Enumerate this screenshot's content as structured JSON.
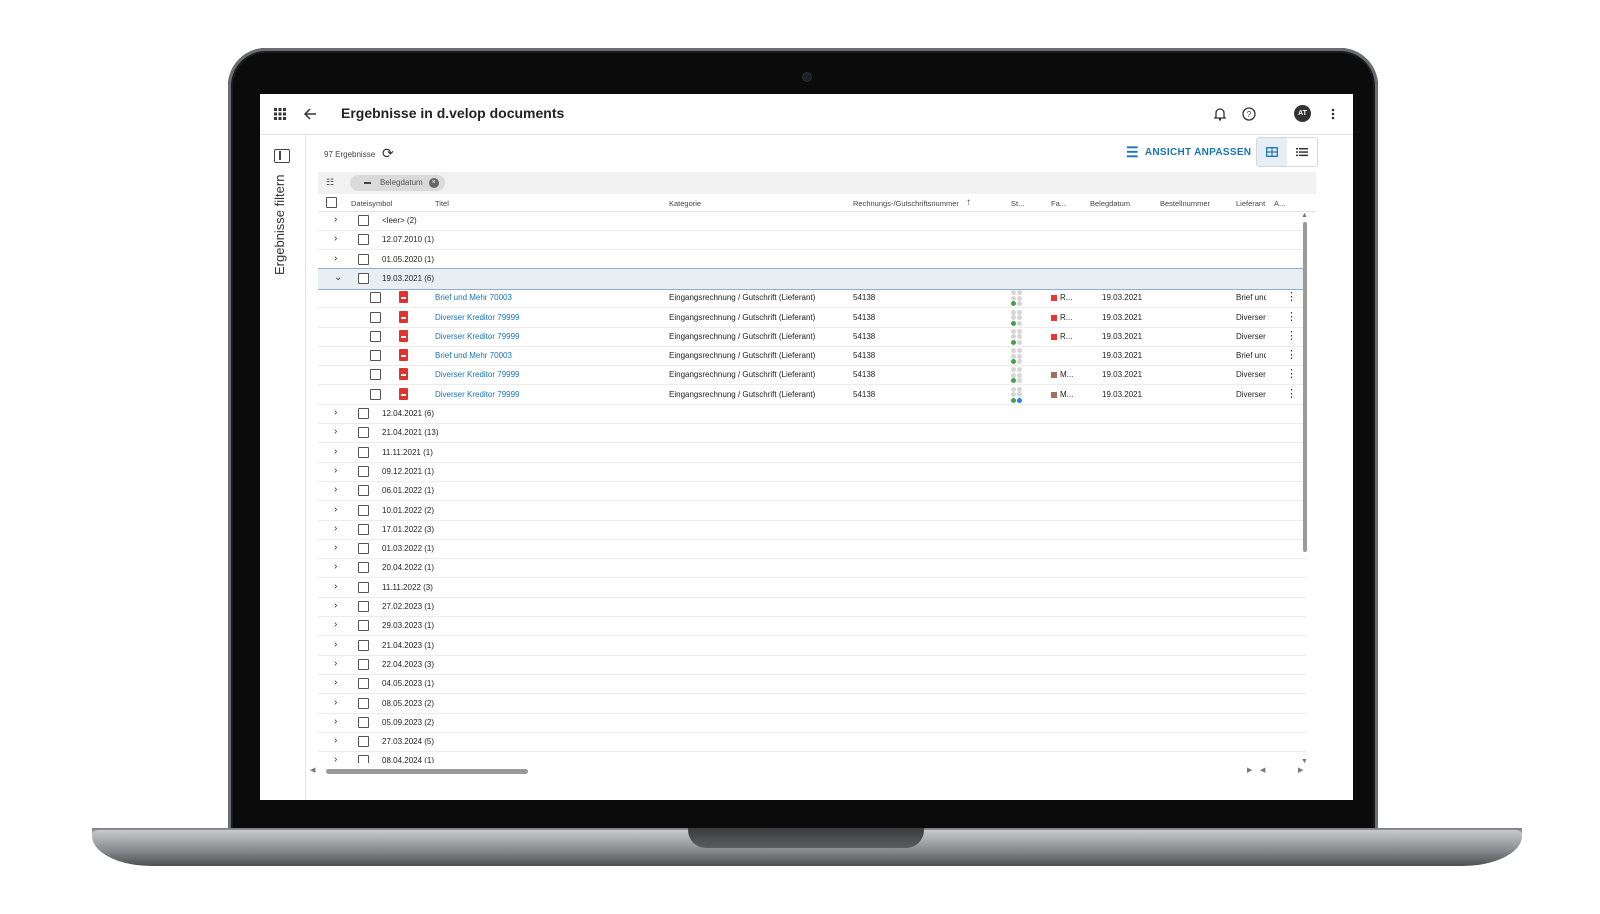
{
  "app": {
    "title": "Ergebnisse in d.velop documents",
    "avatar_initials": "AT",
    "icons": {
      "apps": "apps-grid-icon",
      "back": "arrow-back-icon",
      "notifications": "bell-icon",
      "help": "help-circle-icon",
      "more": "more-vert-icon"
    }
  },
  "sidebar": {
    "label": "Ergebnisse filtern"
  },
  "results": {
    "count_label": "97 Ergebnisse",
    "adjust_view_label": "ANSICHT ANPASSEN",
    "group_chip_label": "Belegdatum"
  },
  "table": {
    "columns": [
      "Dateisymbol",
      "Titel",
      "Kategorie",
      "Rechnungs-/Gutschriftsnummer",
      "St...",
      "Fa...",
      "Belegdatum",
      "Bestellnummer",
      "Lieferant",
      "A..."
    ],
    "sorted_column": "Rechnungs-/Gutschriftsnummer",
    "groups_top": [
      {
        "label": "<leer> (2)"
      },
      {
        "label": "12.07.2010 (1)"
      },
      {
        "label": "01.05.2020 (1)"
      }
    ],
    "expanded_group": {
      "label": "19.03.2021 (6)"
    },
    "docs": [
      {
        "title": "Brief und Mehr 70003",
        "category": "Eingangsrechnung / Gutschrift (Lieferant)",
        "number": "54138",
        "fa": "R...",
        "fa_color": "#e53935",
        "date": "19.03.2021",
        "supplier": "Brief und Mehr",
        "status": [
          "#d6d6d6",
          "#d6d6d6",
          "#d6d6d6",
          "#d6d6d6",
          "#43a047",
          "#d6d6d6"
        ]
      },
      {
        "title": "Diverser Kreditor 79999",
        "category": "Eingangsrechnung / Gutschrift (Lieferant)",
        "number": "54138",
        "fa": "R...",
        "fa_color": "#e53935",
        "date": "19.03.2021",
        "supplier": "Diverser Kreditor",
        "status": [
          "#d6d6d6",
          "#d6d6d6",
          "#d6d6d6",
          "#d6d6d6",
          "#43a047",
          "#d6d6d6"
        ]
      },
      {
        "title": "Diverser Kreditor 79999",
        "category": "Eingangsrechnung / Gutschrift (Lieferant)",
        "number": "54138",
        "fa": "R...",
        "fa_color": "#e53935",
        "date": "19.03.2021",
        "supplier": "Diverser Kreditor",
        "status": [
          "#d6d6d6",
          "#d6d6d6",
          "#d6d6d6",
          "#d6d6d6",
          "#43a047",
          "#d6d6d6"
        ]
      },
      {
        "title": "Brief und Mehr 70003",
        "category": "Eingangsrechnung / Gutschrift (Lieferant)",
        "number": "54138",
        "fa": "",
        "fa_color": "",
        "date": "19.03.2021",
        "supplier": "Brief und Mehr",
        "status": [
          "#d6d6d6",
          "#d6d6d6",
          "#d6d6d6",
          "#d6d6d6",
          "#43a047",
          "#d6d6d6"
        ]
      },
      {
        "title": "Diverser Kreditor 79999",
        "category": "Eingangsrechnung / Gutschrift (Lieferant)",
        "number": "54138",
        "fa": "M...",
        "fa_color": "#a1705a",
        "date": "19.03.2021",
        "supplier": "Diverser Kreditor",
        "status": [
          "#d6d6d6",
          "#d6d6d6",
          "#d6d6d6",
          "#d6d6d6",
          "#43a047",
          "#d6d6d6"
        ]
      },
      {
        "title": "Diverser Kreditor 79999",
        "category": "Eingangsrechnung / Gutschrift (Lieferant)",
        "number": "54138",
        "fa": "M...",
        "fa_color": "#a1705a",
        "date": "19.03.2021",
        "supplier": "Diverser Kreditor",
        "status": [
          "#d6d6d6",
          "#d6d6d6",
          "#d6d6d6",
          "#d6d6d6",
          "#43a047",
          "#1e88e5"
        ]
      }
    ],
    "groups_bottom": [
      {
        "label": "12.04.2021 (6)"
      },
      {
        "label": "21.04.2021 (13)"
      },
      {
        "label": "11.11.2021 (1)"
      },
      {
        "label": "09.12.2021 (1)"
      },
      {
        "label": "06.01.2022 (1)"
      },
      {
        "label": "10.01.2022 (2)"
      },
      {
        "label": "17.01.2022 (3)"
      },
      {
        "label": "01.03.2022 (1)"
      },
      {
        "label": "20.04.2022 (1)"
      },
      {
        "label": "11.11.2022 (3)"
      },
      {
        "label": "27.02.2023 (1)"
      },
      {
        "label": "29.03.2023 (1)"
      },
      {
        "label": "21.04.2023 (1)"
      },
      {
        "label": "22.04.2023 (3)"
      },
      {
        "label": "04.05.2023 (1)"
      },
      {
        "label": "08.05.2023 (2)"
      },
      {
        "label": "05.09.2023 (2)"
      },
      {
        "label": "27.03.2024 (5)"
      },
      {
        "label": "08.04.2024 (1)"
      }
    ]
  },
  "colors": {
    "accent": "#1a73b8",
    "pdf": "#e0332d",
    "selected_row": "#e9eef4"
  }
}
